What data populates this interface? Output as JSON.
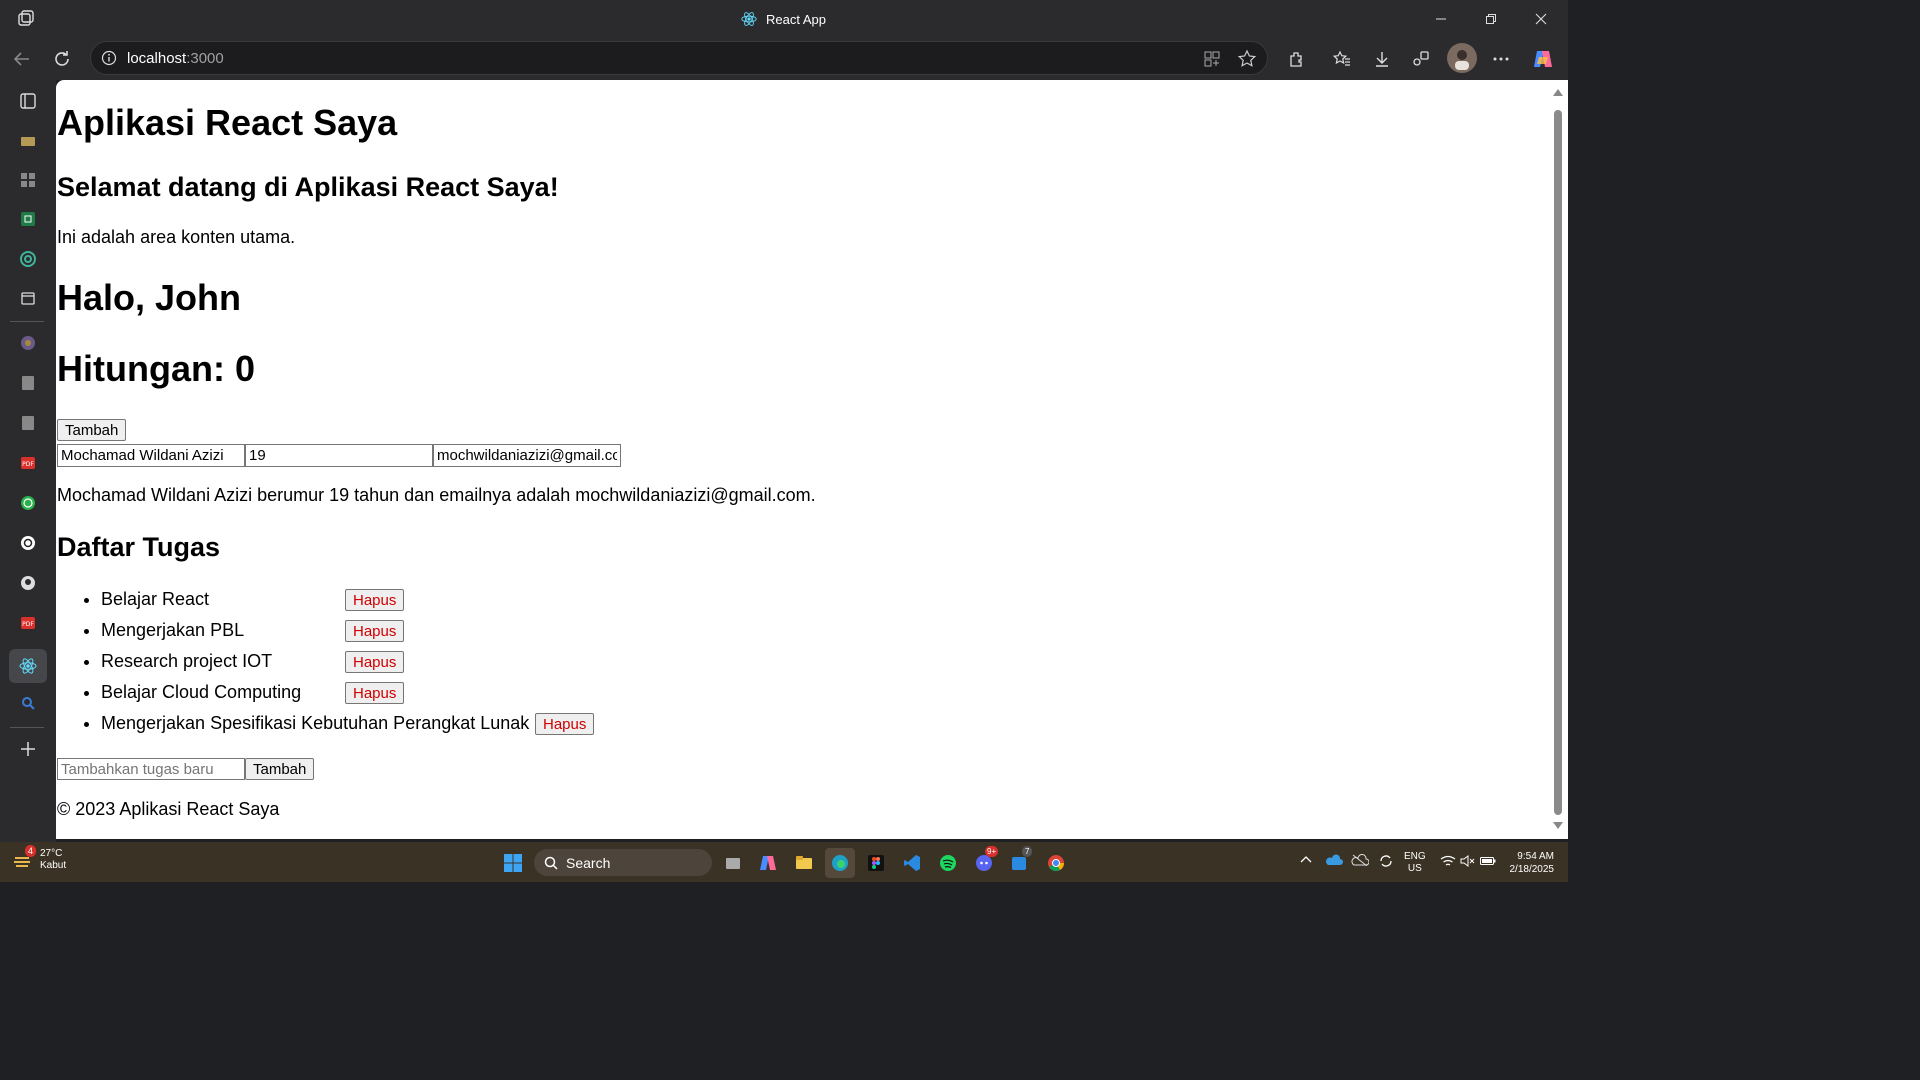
{
  "browser": {
    "window_title": "React App",
    "address": {
      "host": "localhost",
      "port": ":3000"
    }
  },
  "page": {
    "app_title": "Aplikasi React Saya",
    "welcome": "Selamat datang di Aplikasi React Saya!",
    "content_text": "Ini adalah area konten utama.",
    "greeting": "Halo, John",
    "counter_text": "Hitungan: 0",
    "add_button": "Tambah",
    "inputs": {
      "name": "Mochamad Wildani Azizi",
      "age": "19",
      "email": "mochwildaniazizi@gmail.co"
    },
    "summary": "Mochamad Wildani Azizi berumur 19 tahun dan emailnya adalah mochwildaniazizi@gmail.com.",
    "tasks_heading": "Daftar Tugas",
    "tasks": [
      {
        "text": "Belajar React",
        "delete_label": "Hapus"
      },
      {
        "text": "Mengerjakan PBL",
        "delete_label": "Hapus"
      },
      {
        "text": "Research project IOT",
        "delete_label": "Hapus"
      },
      {
        "text": "Belajar Cloud Computing",
        "delete_label": "Hapus"
      },
      {
        "text": "Mengerjakan Spesifikasi Kebutuhan Perangkat Lunak",
        "delete_label": "Hapus"
      }
    ],
    "new_task_placeholder": "Tambahkan tugas baru",
    "new_task_button": "Tambah",
    "footer": "© 2023 Aplikasi React Saya"
  },
  "taskbar": {
    "weather": {
      "temp": "27°C",
      "condition": "Kabut",
      "badge": "4"
    },
    "search_label": "Search",
    "language": {
      "line1": "ENG",
      "line2": "US"
    },
    "time": "9:54 AM",
    "date": "2/18/2025",
    "discord_badge": "9+",
    "teams_badge": "7"
  },
  "colors": {
    "delete_button_text": "#d00000",
    "taskbar_bg": "#3b3226",
    "browser_chrome": "#2b2b2d"
  }
}
